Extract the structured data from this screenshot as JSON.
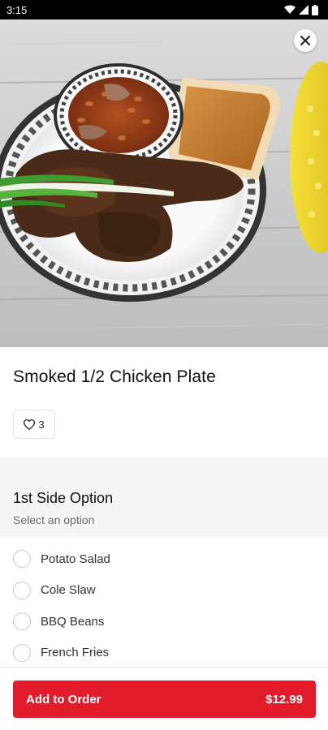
{
  "status_bar": {
    "time": "3:15"
  },
  "product": {
    "title": "Smoked 1/2 Chicken Plate",
    "likes": "3",
    "image_alt": "Smoked chicken with baked beans, toast and corn"
  },
  "side_option": {
    "title": "1st Side Option",
    "subtitle": "Select an option",
    "options": [
      "Potato Salad",
      "Cole Slaw",
      "BBQ Beans",
      "French Fries"
    ]
  },
  "footer": {
    "add_label": "Add to Order",
    "price": "$12.99"
  },
  "colors": {
    "accent": "#e31c2b",
    "section_bg": "#f5f5f5"
  },
  "icons": {
    "close": "close-icon",
    "heart": "heart-outline-icon",
    "wifi": "wifi-icon",
    "signal": "signal-icon",
    "battery": "battery-icon"
  }
}
